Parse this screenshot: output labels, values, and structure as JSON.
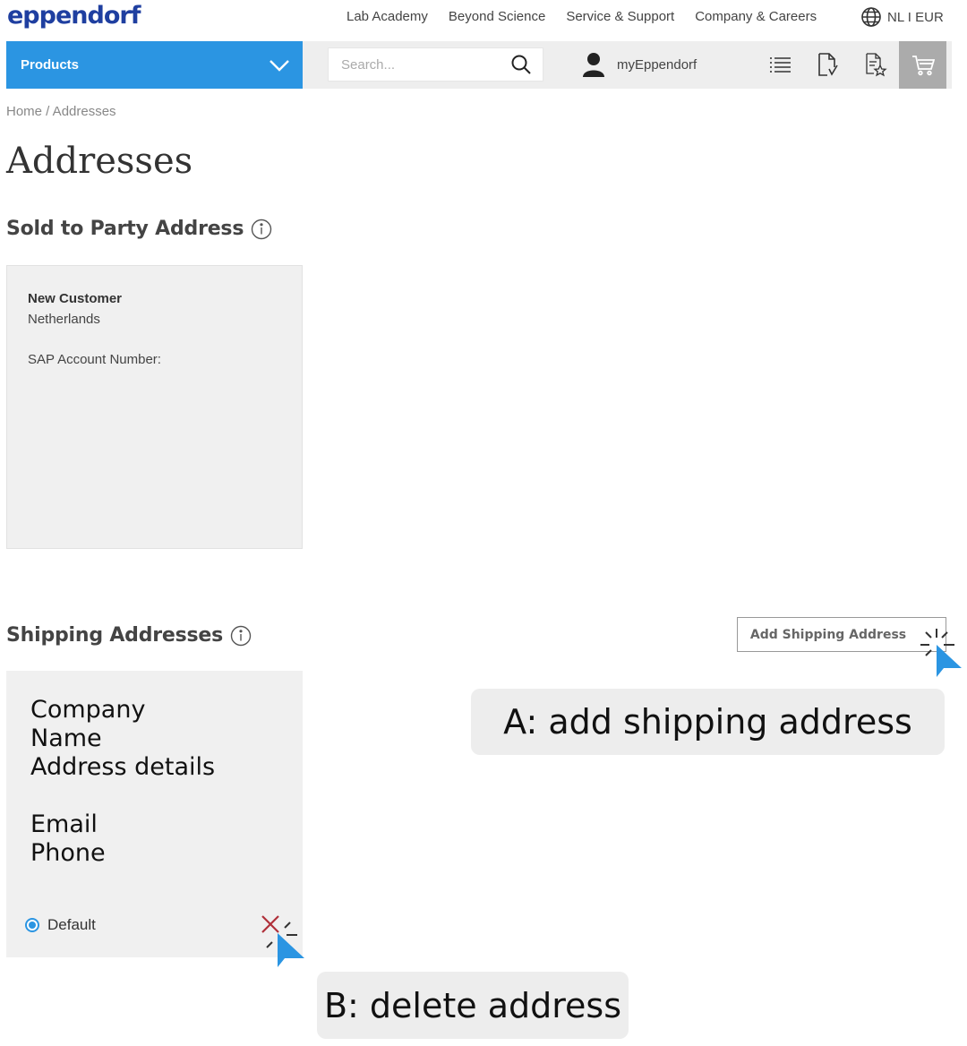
{
  "header": {
    "logo": "eppendorf",
    "nav": [
      "Lab Academy",
      "Beyond Science",
      "Service & Support",
      "Company & Careers"
    ],
    "lang_label": "NL I EUR",
    "products_label": "Products",
    "search_placeholder": "Search...",
    "account_label": "myEppendorf"
  },
  "breadcrumb": "Home / Addresses",
  "page_title": "Addresses",
  "sold_to": {
    "title": "Sold to Party Address",
    "name": "New Customer",
    "country": "Netherlands",
    "sap_label": "SAP Account Number:"
  },
  "shipping": {
    "title": "Shipping Addresses",
    "add_button": "Add Shipping Address",
    "card": {
      "line1": "Company",
      "line2": "Name",
      "line3": "Address details",
      "line4": "Email",
      "line5": "Phone",
      "default_label": "Default"
    }
  },
  "annotations": {
    "a": "A: add shipping address",
    "b": "B: delete address"
  },
  "colors": {
    "accent": "#2b95e2",
    "navbar_gray": "#eeeeee",
    "cart_gray": "#ababab",
    "delete_red": "#b0303a"
  }
}
